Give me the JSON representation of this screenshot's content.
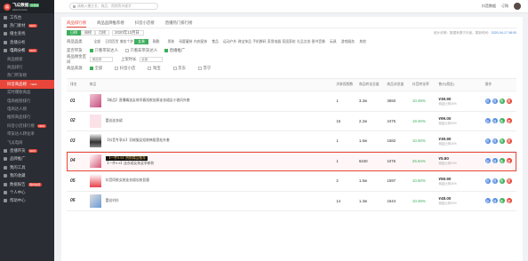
{
  "brand": {
    "name": "飞瓜数据",
    "version": "抖音版",
    "tagline": "FEIGUA DATA"
  },
  "sidebar": {
    "items": [
      {
        "label": "工作台",
        "type": "top"
      },
      {
        "label": "热门素材",
        "type": "top",
        "badge": "NEW"
      },
      {
        "label": "播主查找",
        "type": "top"
      },
      {
        "label": "直播分析",
        "type": "top"
      },
      {
        "label": "电商分析",
        "type": "open",
        "badge": "NEW"
      },
      {
        "label": "商品搜索",
        "type": "sub"
      },
      {
        "label": "商品排行",
        "type": "sub"
      },
      {
        "label": "热门带货榜",
        "type": "sub"
      },
      {
        "label": "抖音商品榜",
        "type": "sub",
        "active": true,
        "badge": "NEW"
      },
      {
        "label": "实时爆款商品",
        "type": "sub"
      },
      {
        "label": "电商视频排行",
        "type": "sub"
      },
      {
        "label": "电商达人榜",
        "type": "sub"
      },
      {
        "label": "推荐商品排行",
        "type": "sub"
      },
      {
        "label": "抖音小店排行榜",
        "type": "sub",
        "badge": "NEW"
      },
      {
        "label": "带货达人转化率",
        "type": "sub"
      },
      {
        "label": "飞瓜电商",
        "type": "sub"
      },
      {
        "label": "直播带货",
        "type": "top",
        "badge": "NEW"
      },
      {
        "label": "品牌推广",
        "type": "top"
      },
      {
        "label": "我的工具",
        "type": "top"
      },
      {
        "label": "我的收藏",
        "type": "top"
      },
      {
        "label": "数据报告",
        "type": "top",
        "badge": "限时免费"
      },
      {
        "label": "个人中心",
        "type": "top"
      },
      {
        "label": "帮助中心",
        "type": "top"
      }
    ]
  },
  "topbar": {
    "search_placeholder": "请输入播主名、商品、视频等关键字",
    "right_link": "抖音数据",
    "mini_link": "订购"
  },
  "tabs": [
    "商品排行榜",
    "商品品牌推荐榜",
    "抖音小店榜",
    "直播热门排行榜"
  ],
  "date_filter": {
    "buttons": [
      "日榜",
      "周榜",
      "月榜"
    ],
    "active": "日榜",
    "date": "2020年12月日",
    "note": "统计说明：数据来源于抖音，更新时间：",
    "time": "2020-04-17 08:00"
  },
  "category": {
    "label": "商品品类",
    "items": [
      "全部",
      "日用百货",
      "美妆个护",
      "女装",
      "鞋靴",
      "男装",
      "母婴童装",
      "内衣配饰",
      "食品",
      "运动户外",
      "珠宝饰品",
      "手机数码",
      "家用电器",
      "家居家纺",
      "礼品文创",
      "图书音像",
      "玩具",
      "游戏服务",
      "其他"
    ],
    "active": "女装"
  },
  "source": {
    "label": "是否带货",
    "options": [
      {
        "label": "只看带货达人",
        "checked": true
      },
      {
        "label": "只看非带货达人",
        "checked": false
      },
      {
        "label": "直播推广",
        "checked": true
      }
    ]
  },
  "price_filter": {
    "label": "商品佣金区间",
    "sel1": "请选择",
    "label2": "上架时长",
    "sel2": "全部"
  },
  "source_filter": {
    "label": "商品来源",
    "options": [
      "全部",
      "抖音小店",
      "淘宝",
      "京东",
      "苏宁"
    ]
  },
  "table": {
    "headers": [
      "排名",
      "商品",
      "关联视频数",
      "商品转化总量",
      "商品浏览量",
      "抖音转化率",
      "售价(佣金)",
      "操作"
    ],
    "rows": [
      {
        "rank": "01",
        "name": "【新品】直播精选女装早春短款加厚连衣裙女小香风外套",
        "thumb": "t1",
        "videos": "1",
        "sales": "3.3w",
        "views": "3650",
        "rate": "10.49%",
        "price": "¥39.90",
        "commission": "佣金比例30%"
      },
      {
        "rank": "02",
        "name": "蕾丝连衣裙",
        "thumb": "t2",
        "videos": "15",
        "sales": "2.2w",
        "views": "2475",
        "rate": "19.40%",
        "price": "¥99.00",
        "commission": "佣金比例20%"
      },
      {
        "rank": "03",
        "name": "【抖音专享价】羽绒服女短款韩版宽松外套",
        "thumb": "t3",
        "videos": "1",
        "sales": "1.6w",
        "views": "1682",
        "rate": "10.00%",
        "price": "¥39.90",
        "commission": "佣金比例20%"
      },
      {
        "rank": "04",
        "name": "【一件9.9】连衣裙女装夏季新款",
        "thumb": "t4",
        "highlight": true,
        "tag": "【一件9.9】热销商品推荐",
        "videos": "1",
        "sales": "6340",
        "views": "1076",
        "rate": "25.54%",
        "price": "¥5.80",
        "commission": "佣金比例10%"
      },
      {
        "rank": "05",
        "name": "抖音同款女装连衣裙长款显瘦",
        "thumb": "t5",
        "videos": "2",
        "sales": "1.5w",
        "views": "1597",
        "rate": "10.50%",
        "price": "¥59.90",
        "commission": "佣金比例30%"
      },
      {
        "rank": "06",
        "name": "蕾丝衬衫",
        "thumb": "t6",
        "videos": "14",
        "sales": "1.3w",
        "views": "1544",
        "rate": "10.49%",
        "price": "¥48.00",
        "commission": "佣金比例20%"
      }
    ]
  }
}
